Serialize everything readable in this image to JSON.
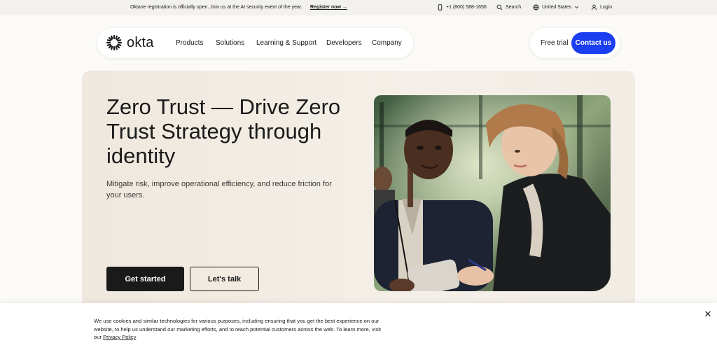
{
  "topbar": {
    "announcement": "Oktane registration is officially open. Join us at the AI security event of the year.",
    "register_link": "Register now →",
    "phone": "+1 (800) 588-1656",
    "search": "Search",
    "region": "United States",
    "login": "Login"
  },
  "nav": {
    "logo_text": "okta",
    "items": [
      {
        "label": "Products"
      },
      {
        "label": "Solutions"
      },
      {
        "label": "Learning & Support"
      },
      {
        "label": "Developers"
      },
      {
        "label": "Company"
      }
    ],
    "free_trial": "Free trial",
    "contact": "Contact us"
  },
  "hero": {
    "title": "Zero Trust — Drive Zero Trust Strategy through identity",
    "subtitle": "Mitigate risk, improve operational efficiency, and reduce friction for your users.",
    "primary_cta": "Get started",
    "secondary_cta": "Let's talk"
  },
  "cookie": {
    "text": "We use cookies and similar technologies for various purposes, including ensuring that you get the best experience on our website, to help us understand our marketing efforts, and to reach potential customers across the web. To learn more, visit our",
    "link": "Privacy Policy",
    "close_icon": "close-icon"
  },
  "colors": {
    "accent": "#1a3ef0",
    "dark_button": "#1a1a1a",
    "hero_bg": "#efe8de"
  }
}
